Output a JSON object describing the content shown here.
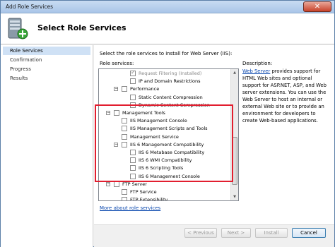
{
  "window": {
    "title": "Add Role Services",
    "close_glyph": "✕"
  },
  "header": {
    "title": "Select Role Services",
    "icon": "server-add-icon"
  },
  "nav": {
    "items": [
      {
        "label": "Role Services",
        "active": true
      },
      {
        "label": "Confirmation",
        "active": false
      },
      {
        "label": "Progress",
        "active": false
      },
      {
        "label": "Results",
        "active": false
      }
    ]
  },
  "content": {
    "intro": "Select the role services to install for Web Server (IIS):",
    "role_services_label": "Role services:",
    "description_label": "Description:",
    "description_link": "Web Server",
    "description_text": " provides support for HTML Web sites and optional support for ASP.NET, ASP, and Web server extensions. You can use the Web Server to host an internal or external Web site or to provide an environment for developers to create Web-based applications.",
    "more_link": "More about role services"
  },
  "tree": {
    "rows": [
      {
        "label": "Request Filtering  (Installed)",
        "checked": true,
        "disabled": true,
        "expander": ""
      },
      {
        "label": "IP and Domain Restrictions",
        "checked": false,
        "disabled": false,
        "expander": ""
      },
      {
        "label": "Performance",
        "checked": false,
        "disabled": false,
        "expander": "−"
      },
      {
        "label": "Static Content Compression",
        "checked": false,
        "disabled": false,
        "expander": ""
      },
      {
        "label": "Dynamic Content Compression",
        "checked": false,
        "disabled": false,
        "expander": ""
      },
      {
        "label": "Management Tools",
        "checked": false,
        "disabled": false,
        "expander": "−"
      },
      {
        "label": "IIS Management Console",
        "checked": false,
        "disabled": false,
        "expander": ""
      },
      {
        "label": "IIS Management Scripts and Tools",
        "checked": false,
        "disabled": false,
        "expander": ""
      },
      {
        "label": "Management Service",
        "checked": false,
        "disabled": false,
        "expander": ""
      },
      {
        "label": "IIS 6 Management Compatibility",
        "checked": false,
        "disabled": false,
        "expander": "−"
      },
      {
        "label": "IIS 6 Metabase Compatibility",
        "checked": false,
        "disabled": false,
        "expander": ""
      },
      {
        "label": "IIS 6 WMI Compatibility",
        "checked": false,
        "disabled": false,
        "expander": ""
      },
      {
        "label": "IIS 6 Scripting Tools",
        "checked": false,
        "disabled": false,
        "expander": ""
      },
      {
        "label": "IIS 6 Management Console",
        "checked": false,
        "disabled": false,
        "expander": ""
      },
      {
        "label": "FTP Server",
        "checked": false,
        "disabled": false,
        "expander": "−"
      },
      {
        "label": "FTP Service",
        "checked": false,
        "disabled": false,
        "expander": ""
      },
      {
        "label": "FTP Extensibility",
        "checked": false,
        "disabled": false,
        "expander": ""
      }
    ],
    "scroll_up_glyph": "▲",
    "scroll_down_glyph": "▼"
  },
  "buttons": {
    "previous": "< Previous",
    "next": "Next >",
    "install": "Install",
    "cancel": "Cancel"
  },
  "colors": {
    "highlight": "#e21e2f",
    "link": "#0645ad",
    "selected_nav": "#cfe1f5"
  }
}
